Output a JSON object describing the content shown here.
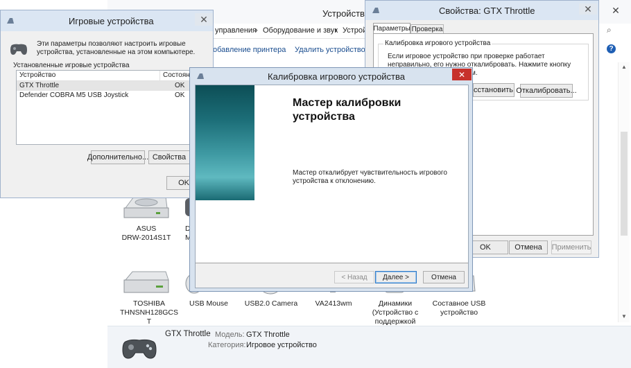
{
  "explorer": {
    "title": "Устройства",
    "breadcrumb": [
      "управления",
      "Оборудование и звук",
      "Устройст"
    ],
    "cmd_add_printer": "обавление принтера",
    "cmd_remove": "Удалить устройство",
    "devices_row1": [
      {
        "line1": "ASUS",
        "line2": "DRW-2014S1T",
        "icon": "optical-drive-icon"
      },
      {
        "line1": "D",
        "line2": "M",
        "icon": "device-icon"
      }
    ],
    "devices_row2": [
      {
        "line1": "TOSHIBA",
        "line2": "THNSNH128GCS",
        "line3": "T",
        "icon": "drive-icon"
      },
      {
        "line1": "USB Mouse",
        "icon": "mouse-icon"
      },
      {
        "line1": "USB2.0 Camera",
        "icon": "camera-icon"
      },
      {
        "line1": "VA2413wm",
        "icon": "monitor-icon"
      },
      {
        "line1": "Динамики",
        "line2": "(Устройство с",
        "line3": "поддержкой",
        "icon": "speaker-icon"
      },
      {
        "line1": "Составное USB",
        "line2": "устройство",
        "icon": "usb-device-icon"
      }
    ],
    "details": {
      "name": "GTX Throttle",
      "model_label": "Модель:",
      "model_value": "GTX Throttle",
      "category_label": "Категория:",
      "category_value": "Игровое устройство"
    }
  },
  "game_controllers": {
    "title": "Игровые устройства",
    "description": "Эти параметры позволяют настроить игровые устройства, установленные на этом компьютере.",
    "installed_label": "Установленные игровые устройства",
    "col_device": "Устройство",
    "col_status": "Состояние",
    "rows": [
      {
        "device": "GTX Throttle",
        "status": "OK"
      },
      {
        "device": "Defender COBRA M5 USB Joystick",
        "status": "OK"
      }
    ],
    "advanced_btn": "Дополнительно...",
    "properties_btn": "Свойства",
    "ok_btn": "OK"
  },
  "properties": {
    "title": "Свойства: GTX Throttle",
    "tabs": [
      "Параметры",
      "Проверка"
    ],
    "group_label": "Калибровка игрового устройства",
    "group_text": "Если игровое устройство при проверке работает неправильно, его нужно откалибровать. Нажмите кнопку \"Откалибровать\" и",
    "group_text_tail": "м.",
    "restore_btn": "сстановить",
    "calibrate_btn": "Откалибровать...",
    "ok_btn": "OK",
    "cancel_btn": "Отмена",
    "apply_btn": "Применить"
  },
  "wizard": {
    "title": "Калибровка игрового устройства",
    "heading": "Мастер калибровки устройства",
    "body": "Мастер откалибрует чувствительность игрового устройства к отклонению.",
    "back_btn": "< Назад",
    "next_btn": "Далее >",
    "cancel_btn": "Отмена"
  },
  "colors": {
    "close_red": "#c7312b",
    "titlebar_blue": "#c4d8ee",
    "teal_dark": "#0d4e56",
    "teal_light": "#5fb9c0"
  }
}
